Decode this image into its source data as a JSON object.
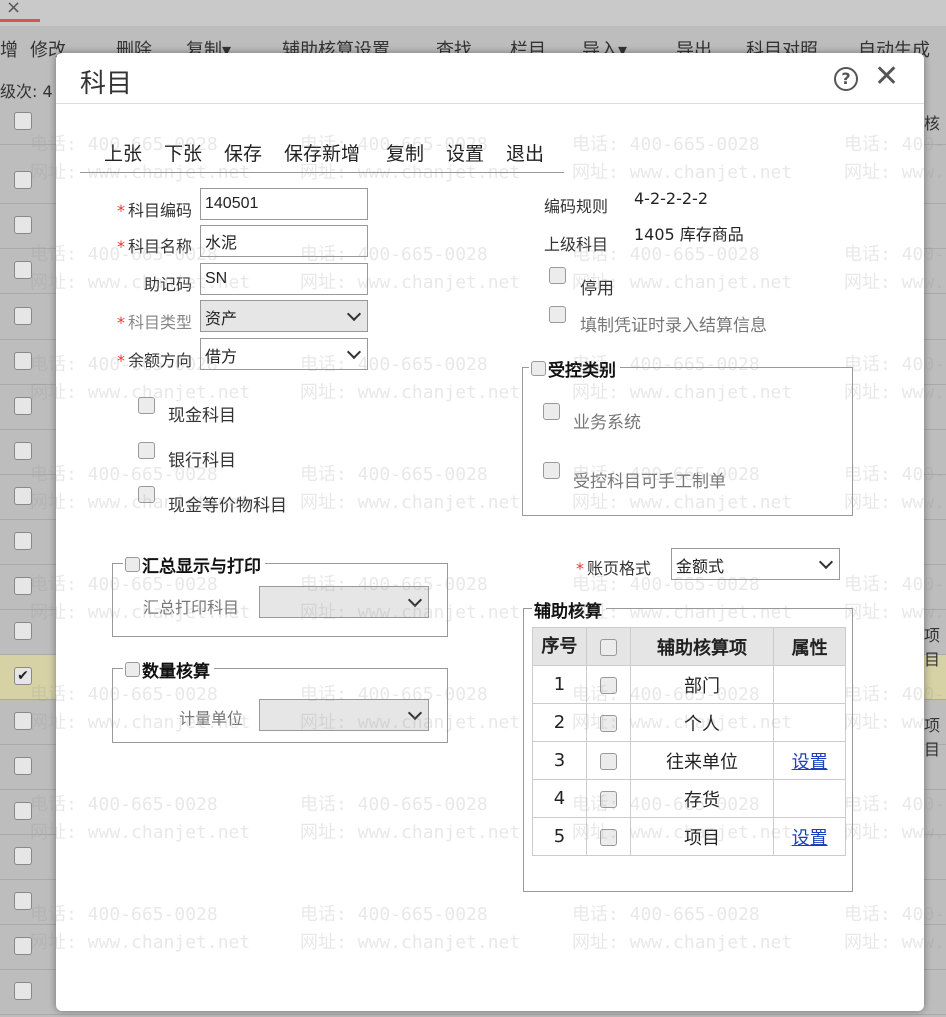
{
  "background": {
    "close_glyph": "×",
    "toolbar": [
      "增",
      "修改",
      "删除",
      "复制▾",
      "辅助核算设置",
      "查找",
      "栏目",
      "导入▾",
      "导出",
      "科目对照",
      "自动生成"
    ],
    "level_label": "级次:  4",
    "right_col": [
      "核",
      "项目",
      "项目"
    ]
  },
  "dialog": {
    "title": "科目",
    "toolbar": [
      "上张",
      "下张",
      "保存",
      "保存新增",
      "复制",
      "设置",
      "退出"
    ],
    "fields": {
      "code_label": "科目编码",
      "code_value": "140501",
      "name_label": "科目名称",
      "name_value": "水泥",
      "mnemonic_label": "助记码",
      "mnemonic_value": "SN",
      "type_label": "科目类型",
      "type_value": "资产",
      "balance_label": "余额方向",
      "balance_value": "借方"
    },
    "right": {
      "rule_label": "编码规则",
      "rule_value": "4-2-2-2-2",
      "parent_label": "上级科目",
      "parent_value": "1405 库存商品",
      "disable_label": "停用",
      "settle_label": "填制凭证时录入结算信息"
    },
    "checkboxes": {
      "cash": "现金科目",
      "bank": "银行科目",
      "cash_equiv": "现金等价物科目"
    },
    "controlled": {
      "legend": "受控类别",
      "business": "业务系统",
      "manual": "受控科目可手工制单"
    },
    "summary": {
      "legend": "汇总显示与打印",
      "print_label": "汇总打印科目"
    },
    "quantity": {
      "legend": "数量核算",
      "unit_label": "计量单位"
    },
    "ledger": {
      "label": "账页格式",
      "value": "金额式"
    },
    "aux": {
      "legend": "辅助核算",
      "headers": [
        "序号",
        "辅助核算项",
        "属性"
      ],
      "rows": [
        {
          "no": "1",
          "item": "部门",
          "attr": ""
        },
        {
          "no": "2",
          "item": "个人",
          "attr": ""
        },
        {
          "no": "3",
          "item": "往来单位",
          "attr": "设置"
        },
        {
          "no": "4",
          "item": "存货",
          "attr": ""
        },
        {
          "no": "5",
          "item": "项目",
          "attr": "设置"
        }
      ]
    }
  },
  "watermark": {
    "phone": "电话: 400-665-0028",
    "web": "网址: www.chanjet.net"
  }
}
